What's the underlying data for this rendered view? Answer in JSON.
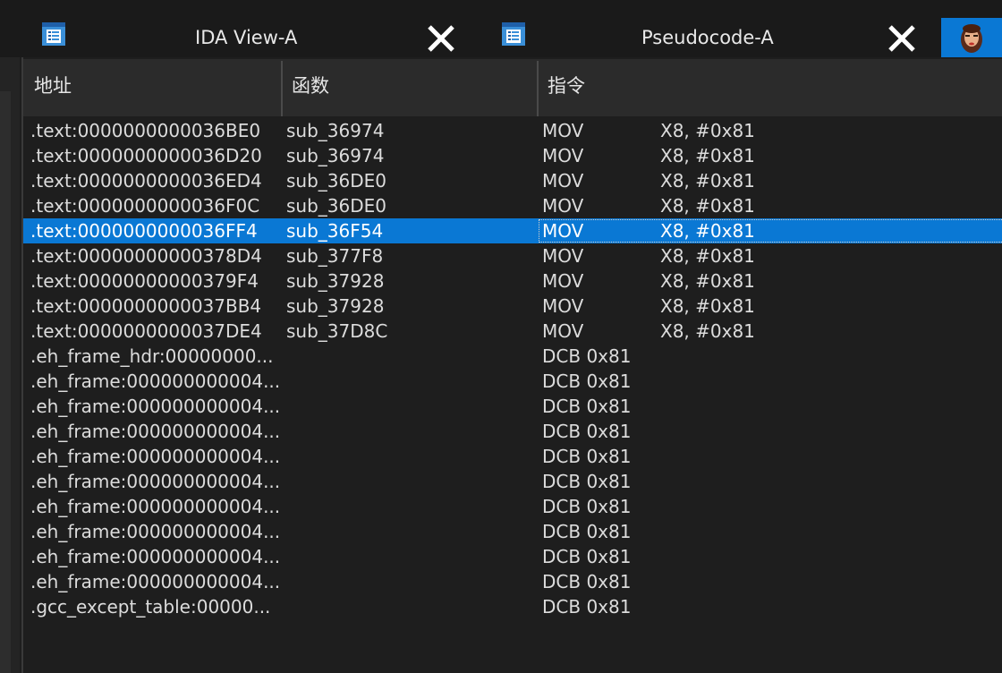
{
  "tabs": [
    {
      "title": "IDA View-A",
      "icon": "listing-icon",
      "close": "close-icon"
    },
    {
      "title": "Pseudocode-A",
      "icon": "listing-icon",
      "close": "close-icon"
    }
  ],
  "table": {
    "columns": [
      "地址",
      "函数",
      "指令"
    ],
    "selected_row": 4,
    "rows": [
      {
        "addr": ".text:0000000000036BE0",
        "func": "sub_36974",
        "mnem": "MOV",
        "ops": "X8, #0x81"
      },
      {
        "addr": ".text:0000000000036D20",
        "func": "sub_36974",
        "mnem": "MOV",
        "ops": "X8, #0x81"
      },
      {
        "addr": ".text:0000000000036ED4",
        "func": "sub_36DE0",
        "mnem": "MOV",
        "ops": "X8, #0x81"
      },
      {
        "addr": ".text:0000000000036F0C",
        "func": "sub_36DE0",
        "mnem": "MOV",
        "ops": "X8, #0x81"
      },
      {
        "addr": ".text:0000000000036FF4",
        "func": "sub_36F54",
        "mnem": "MOV",
        "ops": "X8, #0x81"
      },
      {
        "addr": ".text:00000000000378D4",
        "func": "sub_377F8",
        "mnem": "MOV",
        "ops": "X8, #0x81"
      },
      {
        "addr": ".text:00000000000379F4",
        "func": "sub_37928",
        "mnem": "MOV",
        "ops": "X8, #0x81"
      },
      {
        "addr": ".text:0000000000037BB4",
        "func": "sub_37928",
        "mnem": "MOV",
        "ops": "X8, #0x81"
      },
      {
        "addr": ".text:0000000000037DE4",
        "func": "sub_37D8C",
        "mnem": "MOV",
        "ops": "X8, #0x81"
      },
      {
        "addr": ".eh_frame_hdr:00000000...",
        "func": "",
        "mnem": "DCB 0x81",
        "ops": ""
      },
      {
        "addr": ".eh_frame:000000000004...",
        "func": "",
        "mnem": "DCB 0x81",
        "ops": ""
      },
      {
        "addr": ".eh_frame:000000000004...",
        "func": "",
        "mnem": "DCB 0x81",
        "ops": ""
      },
      {
        "addr": ".eh_frame:000000000004...",
        "func": "",
        "mnem": "DCB 0x81",
        "ops": ""
      },
      {
        "addr": ".eh_frame:000000000004...",
        "func": "",
        "mnem": "DCB 0x81",
        "ops": ""
      },
      {
        "addr": ".eh_frame:000000000004...",
        "func": "",
        "mnem": "DCB 0x81",
        "ops": ""
      },
      {
        "addr": ".eh_frame:000000000004...",
        "func": "",
        "mnem": "DCB 0x81",
        "ops": ""
      },
      {
        "addr": ".eh_frame:000000000004...",
        "func": "",
        "mnem": "DCB 0x81",
        "ops": ""
      },
      {
        "addr": ".eh_frame:000000000004...",
        "func": "",
        "mnem": "DCB 0x81",
        "ops": ""
      },
      {
        "addr": ".eh_frame:000000000004...",
        "func": "",
        "mnem": "DCB 0x81",
        "ops": ""
      },
      {
        "addr": ".gcc_except_table:00000...",
        "func": "",
        "mnem": "DCB 0x81",
        "ops": ""
      }
    ]
  },
  "colors": {
    "selection": "#0a78d4",
    "background": "#1e1e1e",
    "header": "#2b2b2b"
  }
}
